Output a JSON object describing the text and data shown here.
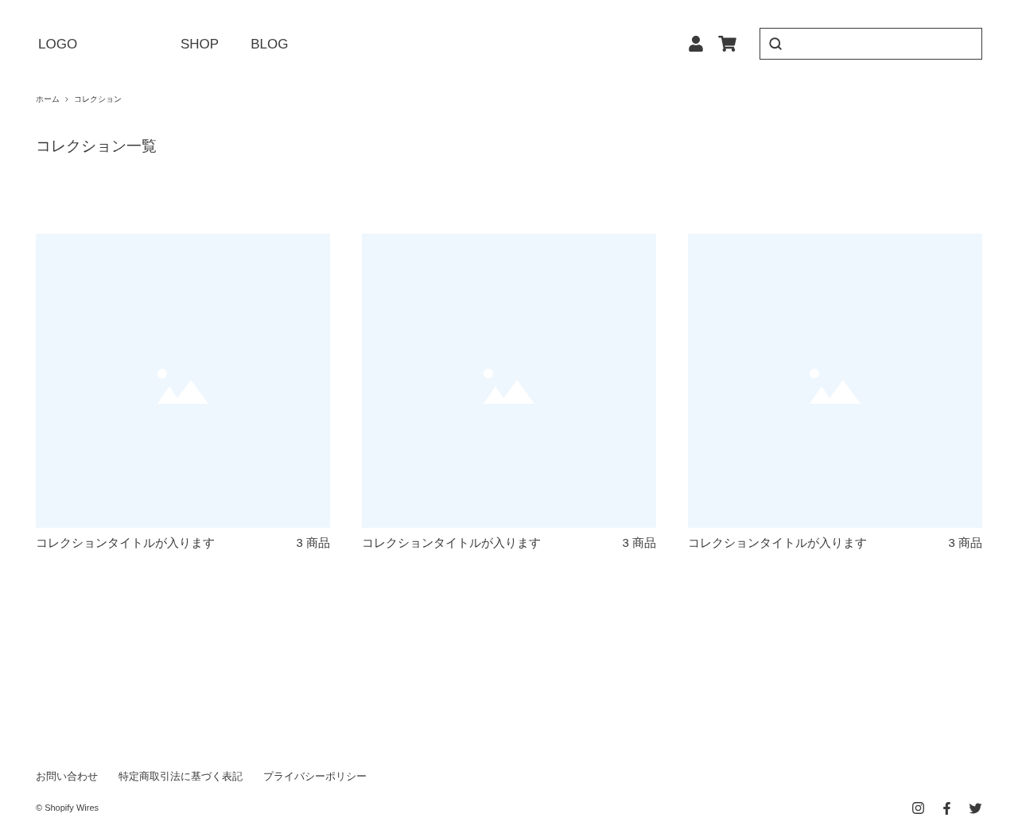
{
  "header": {
    "logo": "LOGO",
    "nav": [
      {
        "label": "SHOP"
      },
      {
        "label": "BLOG"
      }
    ]
  },
  "breadcrumb": [
    {
      "label": "ホーム"
    },
    {
      "label": "コレクション"
    }
  ],
  "page_title": "コレクション一覧",
  "collections": [
    {
      "title": "コレクションタイトルが入ります",
      "count": "3 商品"
    },
    {
      "title": "コレクションタイトルが入ります",
      "count": "3 商品"
    },
    {
      "title": "コレクションタイトルが入ります",
      "count": "3 商品"
    }
  ],
  "footer": {
    "links": [
      {
        "label": "お問い合わせ"
      },
      {
        "label": "特定商取引法に基づく表記"
      },
      {
        "label": "プライバシーポリシー"
      }
    ],
    "copyright": "© Shopify Wires"
  }
}
